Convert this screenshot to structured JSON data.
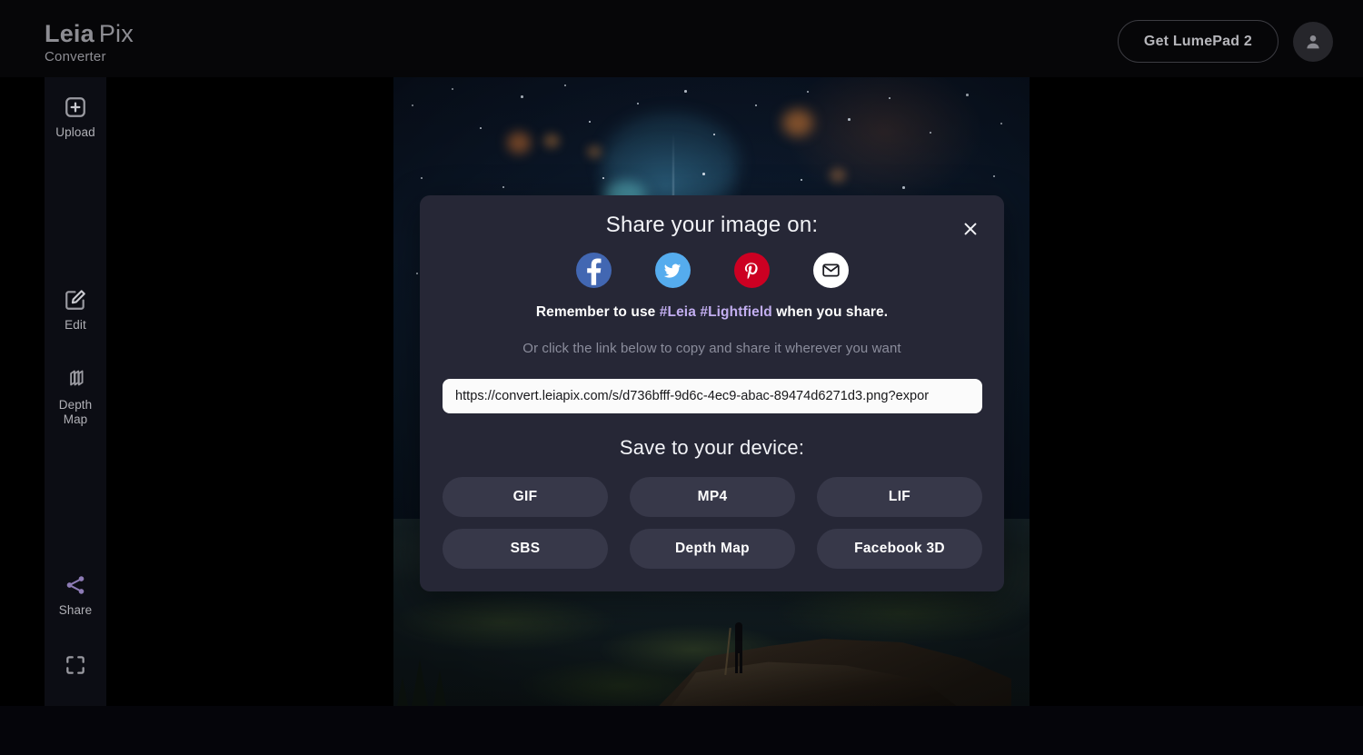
{
  "header": {
    "logo_primary": "Leia",
    "logo_secondary": "Pix",
    "logo_subtitle": "Converter",
    "cta_label": "Get LumePad 2",
    "avatar_icon": "user-avatar-icon"
  },
  "sidebar": {
    "items": [
      {
        "label": "Upload",
        "icon": "plus-square-icon",
        "active": false
      },
      {
        "label": "Edit",
        "icon": "pencil-square-icon",
        "active": false
      },
      {
        "label": "Depth\nMap",
        "label_line1": "Depth",
        "label_line2": "Map",
        "icon": "layers-icon",
        "active": false
      },
      {
        "label": "Share",
        "icon": "share-nodes-icon",
        "active": true
      },
      {
        "label": "",
        "icon": "fullscreen-icon",
        "active": false
      }
    ]
  },
  "modal": {
    "title": "Share your image on:",
    "close_icon": "close-x-icon",
    "social_buttons": [
      {
        "name": "facebook",
        "icon": "facebook-icon",
        "color": "#4267B2"
      },
      {
        "name": "twitter",
        "icon": "twitter-bird-icon",
        "color": "#55ACEE"
      },
      {
        "name": "pinterest",
        "icon": "pinterest-icon",
        "color": "#CC0022"
      },
      {
        "name": "email",
        "icon": "envelope-icon",
        "color": "#FFFFFF"
      }
    ],
    "hashtag_prefix": "Remember to use ",
    "hashtag_1": "#Leia",
    "hashtag_2": "#Lightfield",
    "hashtag_suffix": " when you share.",
    "hashtag_color": "#C2AEF0",
    "sub_text": "Or click the link below to copy and share it wherever you want",
    "share_url": "https://convert.leiapix.com/s/d736bfff-9d6c-4ec9-abac-89474d6271d3.png?expor",
    "save_title": "Save to your device:",
    "save_buttons": [
      {
        "label": "GIF"
      },
      {
        "label": "MP4"
      },
      {
        "label": "LIF"
      },
      {
        "label": "SBS"
      },
      {
        "label": "Depth Map"
      },
      {
        "label": "Facebook 3D"
      }
    ]
  },
  "canvas": {
    "description": "Starry nebula sky above a person standing on a rocky cliff overlooking a green valley"
  },
  "colors": {
    "page_background": "#000000",
    "sidebar_background": "#0C0D14",
    "modal_background": "#262736",
    "save_button_background": "#373849",
    "accent_purple": "#C2AEF0"
  }
}
